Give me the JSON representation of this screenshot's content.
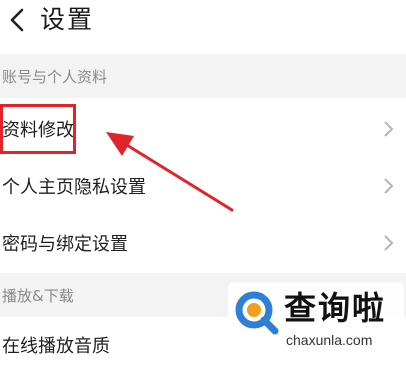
{
  "header": {
    "title": "设置"
  },
  "sections": [
    {
      "label": "账号与个人资料",
      "items": [
        {
          "label": "资料修改"
        },
        {
          "label": "个人主页隐私设置"
        },
        {
          "label": "密码与绑定设置"
        }
      ]
    },
    {
      "label": "播放&下载",
      "items": [
        {
          "label": "在线播放音质"
        }
      ]
    }
  ],
  "watermark": {
    "title": "查询啦",
    "url": "chaxunla.com"
  },
  "colors": {
    "highlight": "#e0242b",
    "section_bg": "#f3f3f3",
    "watermark_logo": "#2e7fd8"
  }
}
